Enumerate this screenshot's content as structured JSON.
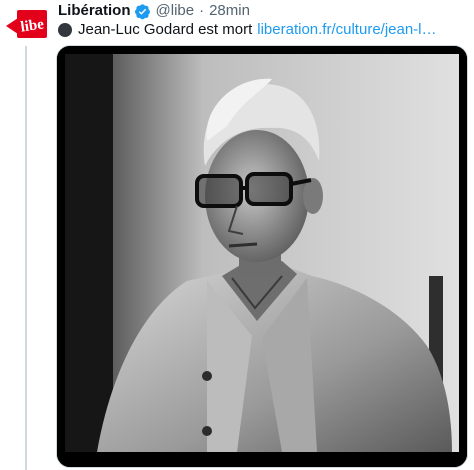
{
  "tweet": {
    "author_name": "Libération",
    "handle": "@libe",
    "separator": "·",
    "time": "28min",
    "text": "Jean-Luc Godard est mort",
    "link": "liberation.fr/culture/jean-l…",
    "avatar_text": "libe",
    "media": {
      "icon": "photo-portrait",
      "colors": {
        "frame": "#000000",
        "background": "#cfcfcf"
      }
    }
  },
  "colors": {
    "accent": "#1d9bf0",
    "secondary_text": "#536471",
    "logo_red": "#e3001b"
  }
}
